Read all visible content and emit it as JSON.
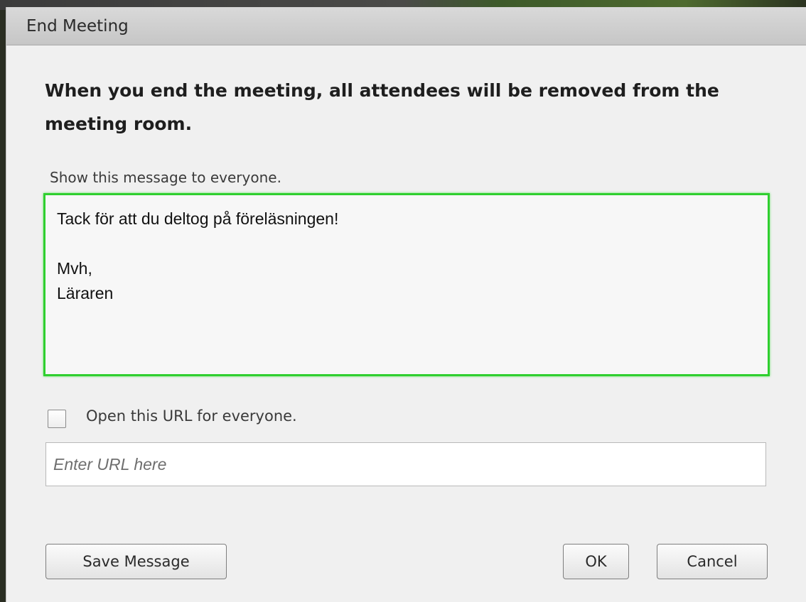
{
  "dialog": {
    "title": "End Meeting",
    "heading": "When you end the meeting, all attendees will be removed from the meeting room.",
    "message_label": "Show this message to everyone.",
    "message_value": "Tack för att du deltog på föreläsningen!\n\nMvh,\nLäraren",
    "url_checkbox_checked": false,
    "url_checkbox_label": "Open this URL for everyone.",
    "url_value": "",
    "url_placeholder": "Enter URL here",
    "buttons": {
      "save": "Save Message",
      "ok": "OK",
      "cancel": "Cancel"
    },
    "colors": {
      "focus_border": "#2fcf2f",
      "dialog_bg": "#f0f0f0",
      "titlebar_bg": "#cfcfcf"
    }
  }
}
